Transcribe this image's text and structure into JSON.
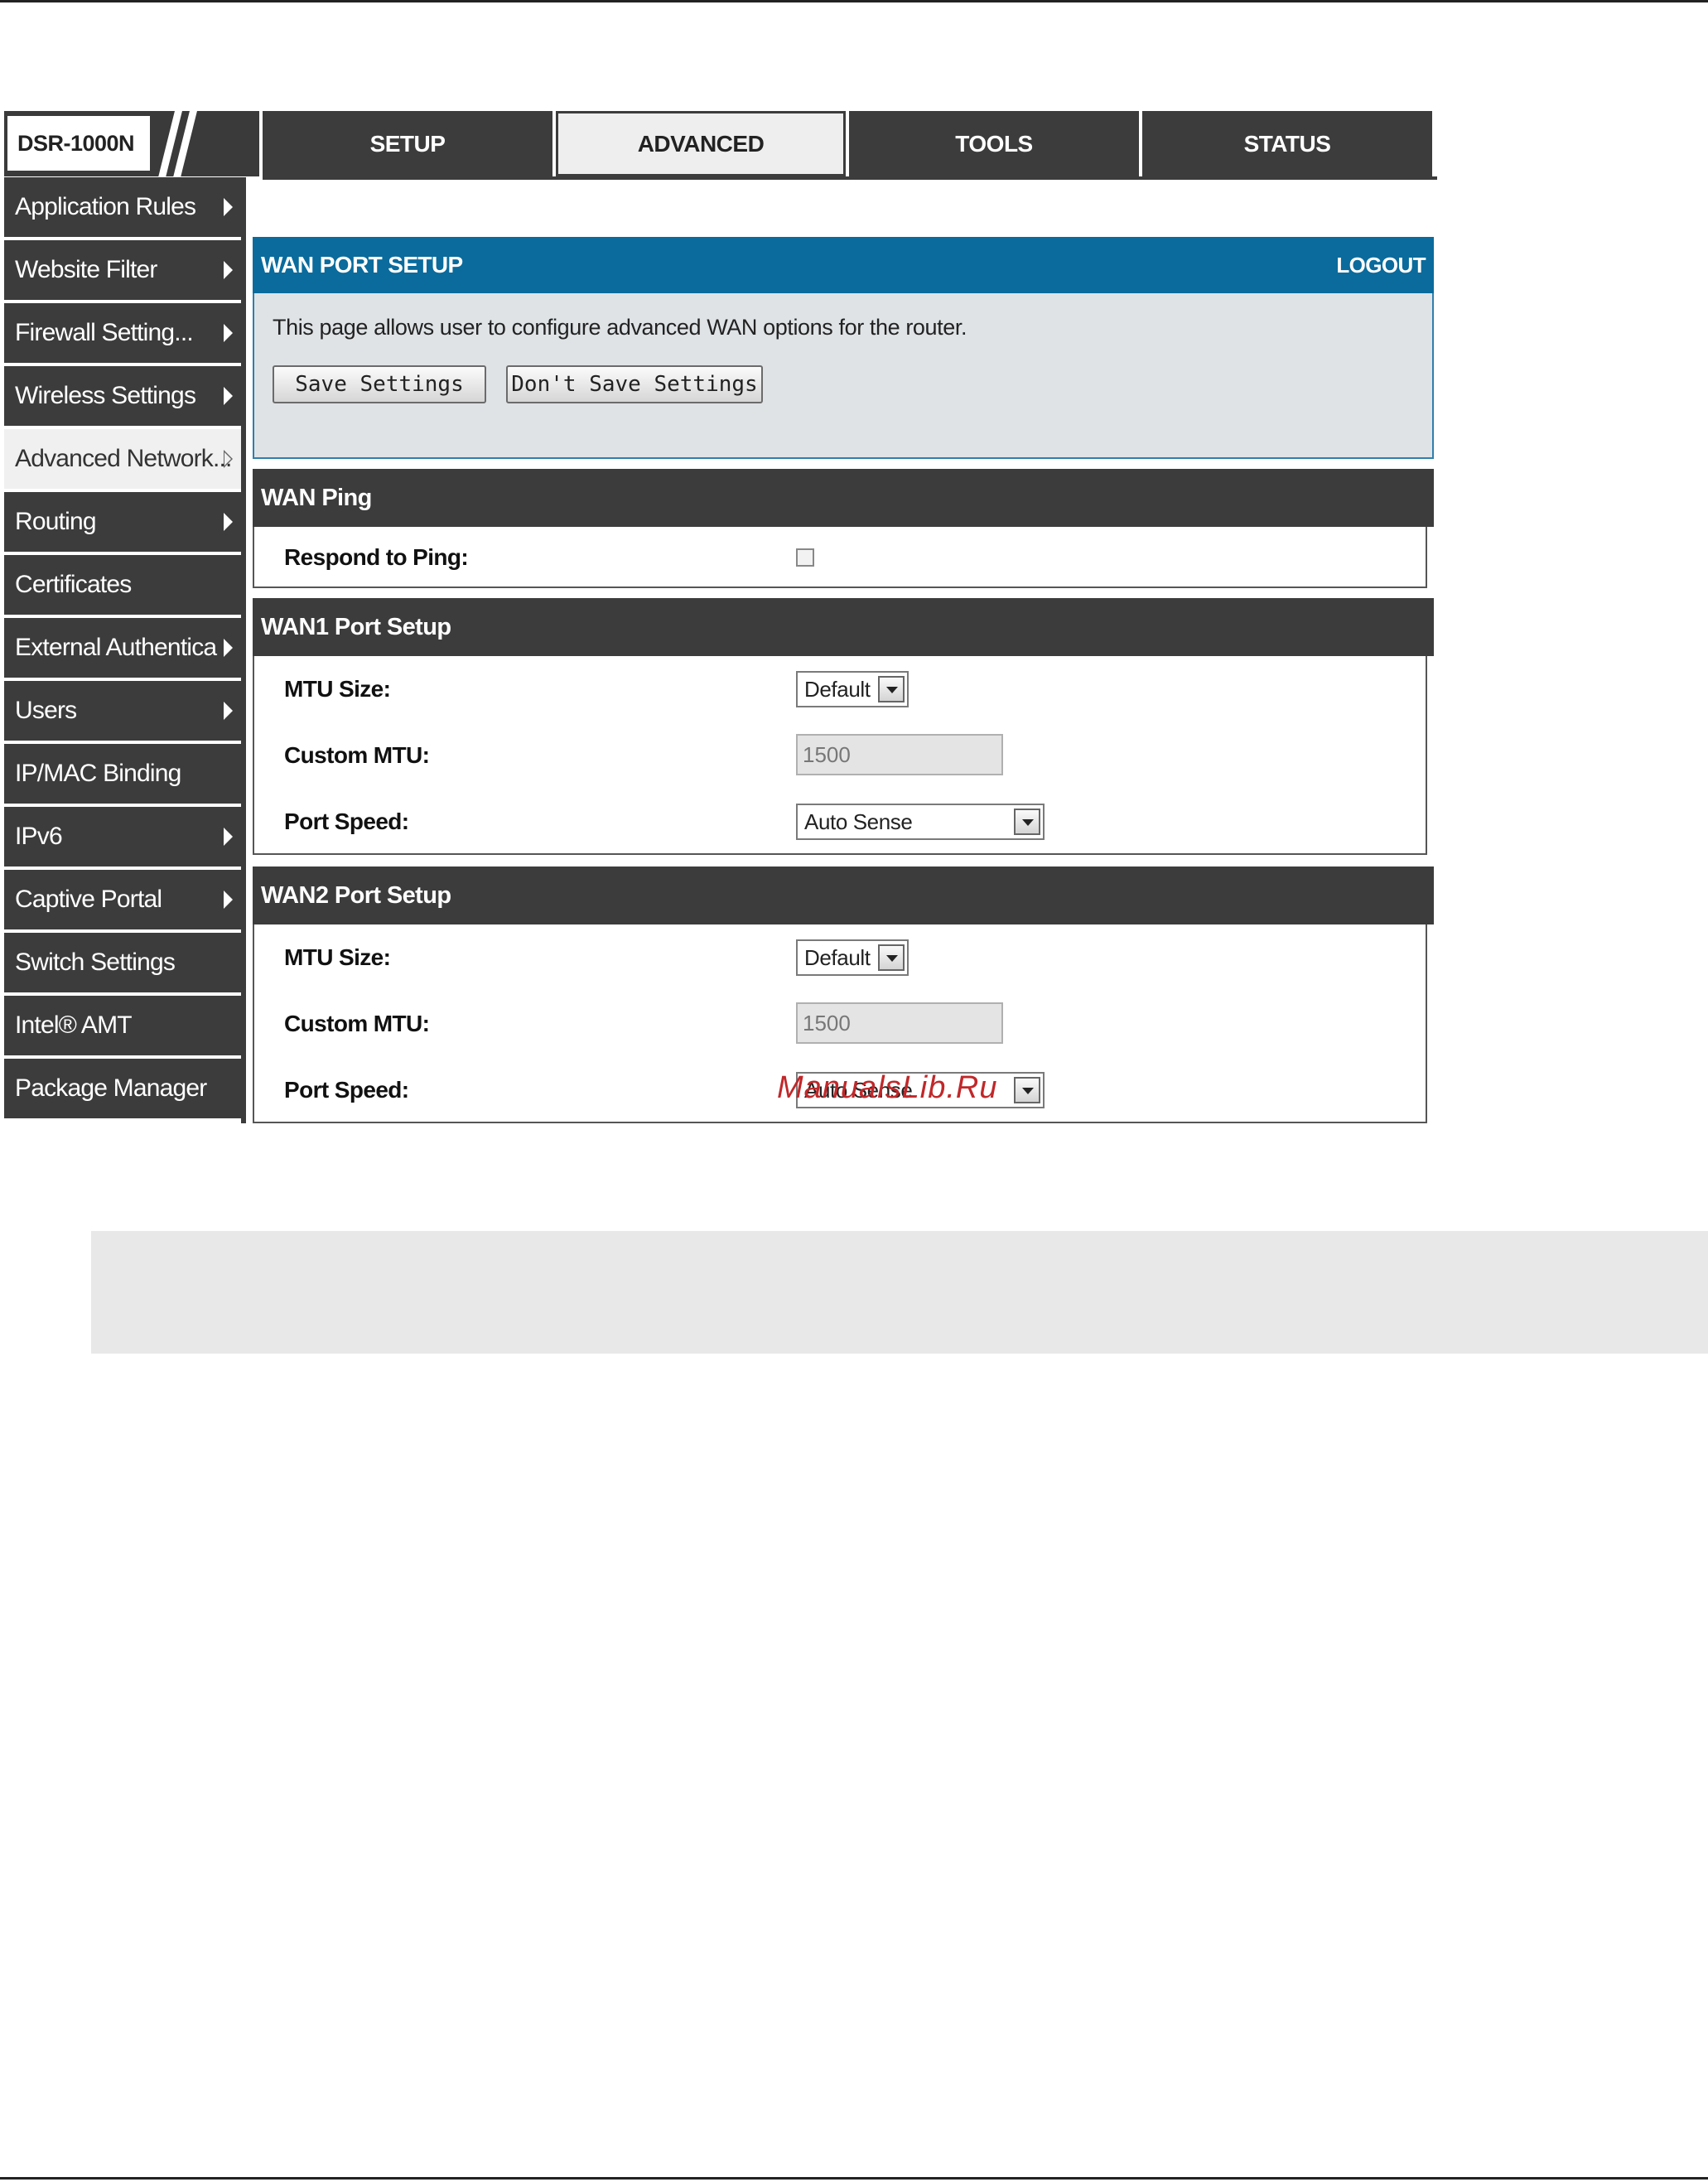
{
  "device": {
    "model": "DSR-1000N"
  },
  "topnav": [
    "SETUP",
    "ADVANCED",
    "TOOLS",
    "STATUS"
  ],
  "sidebar": [
    {
      "label": "Application Rules",
      "arrow": true
    },
    {
      "label": "Website Filter",
      "arrow": true
    },
    {
      "label": "Firewall Setting...",
      "arrow": true
    },
    {
      "label": "Wireless Settings",
      "arrow": true
    },
    {
      "label": "Advanced Network...",
      "arrow": true,
      "active": true
    },
    {
      "label": "Routing",
      "arrow": true
    },
    {
      "label": "Certificates",
      "arrow": false
    },
    {
      "label": "External Authentica",
      "arrow": true
    },
    {
      "label": "Users",
      "arrow": true
    },
    {
      "label": "IP/MAC Binding",
      "arrow": false
    },
    {
      "label": "IPv6",
      "arrow": true
    },
    {
      "label": "Captive Portal",
      "arrow": true
    },
    {
      "label": "Switch Settings",
      "arrow": false
    },
    {
      "label": "Intel® AMT",
      "arrow": false
    },
    {
      "label": "Package Manager",
      "arrow": false
    }
  ],
  "page": {
    "title": "WAN PORT SETUP",
    "logout": "LOGOUT",
    "description": "This page allows user to configure advanced WAN options for the router.",
    "save_label": "Save Settings",
    "dont_save_label": "Don't Save Settings"
  },
  "wan_ping": {
    "title": "WAN Ping",
    "respond_label": "Respond to Ping:",
    "respond_checked": false
  },
  "wan1": {
    "title": "WAN1 Port Setup",
    "mtu_label": "MTU Size:",
    "mtu_value": "Default",
    "custom_label": "Custom MTU:",
    "custom_value": "1500",
    "speed_label": "Port Speed:",
    "speed_value": "Auto Sense"
  },
  "wan2": {
    "title": "WAN2 Port Setup",
    "mtu_label": "MTU Size:",
    "mtu_value": "Default",
    "custom_label": "Custom MTU:",
    "custom_value": "1500",
    "speed_label": "Port Speed:",
    "speed_value": "Auto Sense"
  },
  "watermark": "ManualsLib.Ru",
  "colors": {
    "header_blue": "#0a6b9c",
    "nav_dark": "#3c3c3c",
    "panel_bg": "#dfe3e6"
  }
}
